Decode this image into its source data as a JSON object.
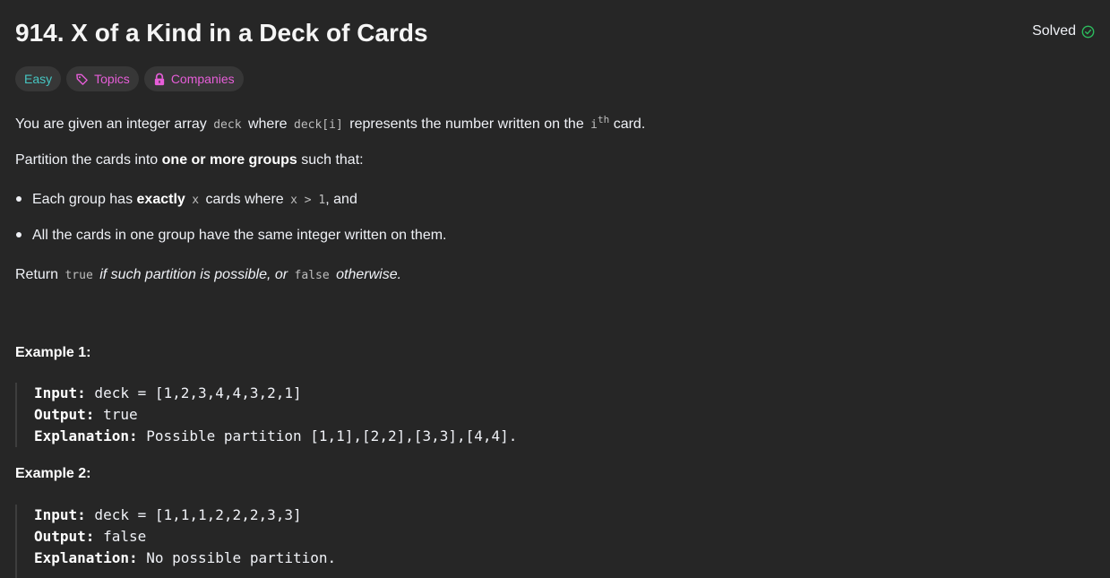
{
  "problem": {
    "title": "914. X of a Kind in a Deck of Cards",
    "status": "Solved"
  },
  "tags": [
    {
      "label": "Easy",
      "color": "#46c6c2"
    },
    {
      "label": "Topics",
      "icon": "tag-icon",
      "color": "#e65ed8"
    },
    {
      "label": "Companies",
      "icon": "lock-icon",
      "color": "#e65ed8"
    }
  ],
  "description": {
    "p1": {
      "t1": "You are given an integer array ",
      "c1": "deck",
      "t2": " where ",
      "c2": "deck[i]",
      "t3": " represents the number written on the ",
      "c3": "i",
      "sup": "th",
      "t4": " card."
    },
    "p2": {
      "t1": "Partition the cards into ",
      "b1": "one or more groups",
      "t2": " such that:"
    },
    "li1": {
      "t1": "Each group has ",
      "b1": "exactly",
      "t2": " ",
      "c1": "x",
      "t3": " cards where ",
      "c2": "x > 1",
      "t4": ", and"
    },
    "li2": {
      "t1": "All the cards in one group have the same integer written on them."
    },
    "p3": {
      "t1": "Return ",
      "c1": "true",
      "i1": " if such partition is possible, or ",
      "c2": "false",
      "i2": " otherwise."
    }
  },
  "examples": [
    {
      "title": "Example 1:",
      "input_label": "Input:",
      "input": " deck = [1,2,3,4,4,3,2,1]",
      "output_label": "Output:",
      "output": " true",
      "explanation_label": "Explanation:",
      "explanation": " Possible partition [1,1],[2,2],[3,3],[4,4]."
    },
    {
      "title": "Example 2:",
      "input_label": "Input:",
      "input": " deck = [1,1,1,2,2,2,3,3]",
      "output_label": "Output:",
      "output": " false",
      "explanation_label": "Explanation:",
      "explanation": " No possible partition."
    }
  ],
  "colors": {
    "background": "#262626",
    "easy": "#46c6c2",
    "accent": "#e65ed8",
    "solved_check": "#2cbb5d"
  }
}
